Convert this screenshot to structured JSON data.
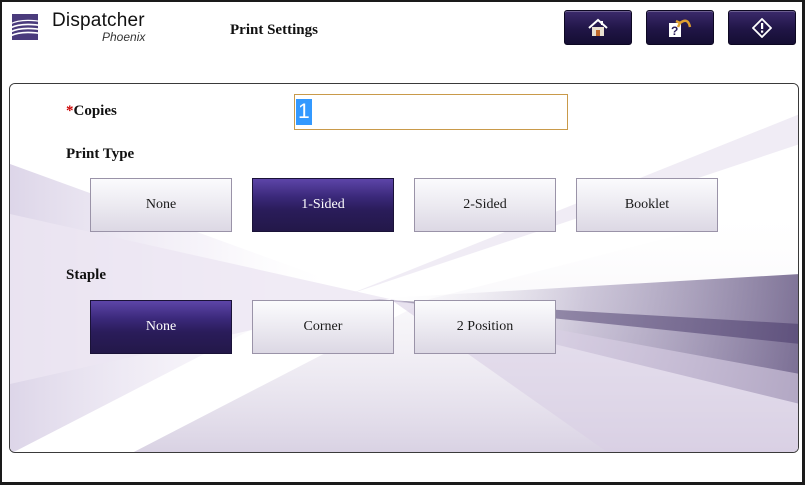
{
  "app": {
    "logo_main": "Dispatcher",
    "logo_sub": "Phoenix",
    "title": "Print Settings"
  },
  "header_buttons": [
    {
      "name": "home",
      "icon": "home-icon"
    },
    {
      "name": "help",
      "icon": "help-back-icon"
    },
    {
      "name": "info",
      "icon": "info-icon"
    }
  ],
  "copies": {
    "required_mark": "*",
    "label": "Copies",
    "value": "1"
  },
  "print_type": {
    "label": "Print Type",
    "options": [
      "None",
      "1-Sided",
      "2-Sided",
      "Booklet"
    ],
    "selected": "1-Sided"
  },
  "staple": {
    "label": "Staple",
    "options": [
      "None",
      "Corner",
      "2 Position"
    ],
    "selected": "None"
  },
  "colors": {
    "accent": "#2a1c5a",
    "required": "#cc0000",
    "input_border": "#c99a4a",
    "selection": "#3399ff"
  }
}
